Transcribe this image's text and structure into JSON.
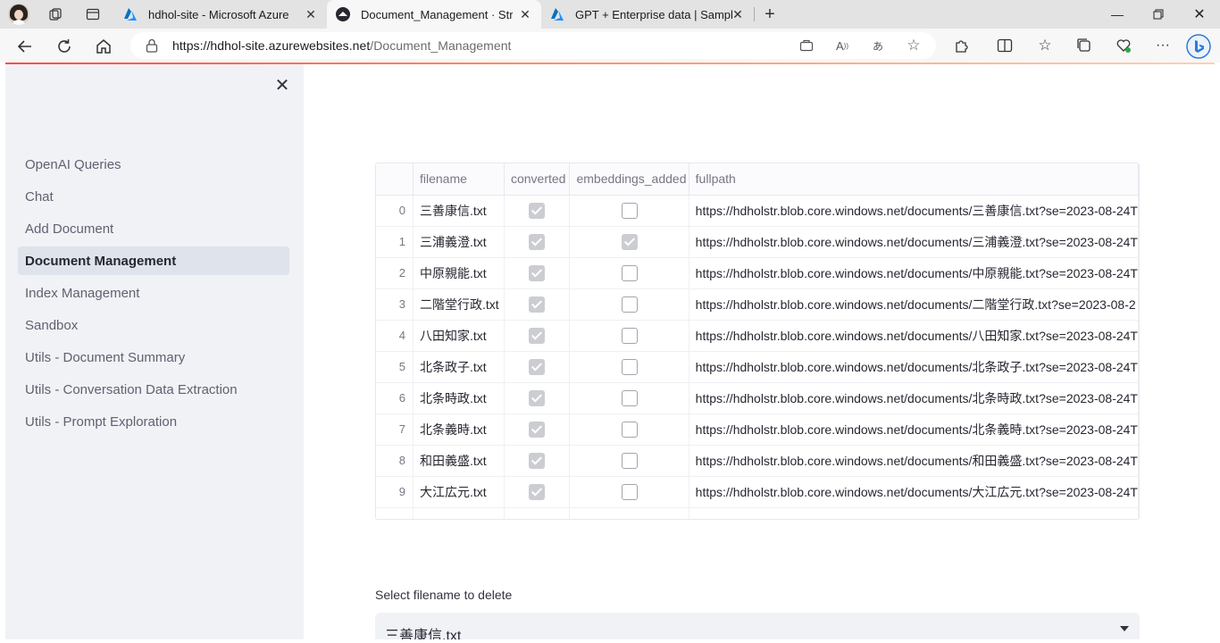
{
  "browser": {
    "tabs": [
      {
        "title": "hdhol-site - Microsoft Azure",
        "icon": "azure-icon",
        "active": false
      },
      {
        "title": "Document_Management · Streamlit",
        "icon": "streamlit-icon",
        "active": true
      },
      {
        "title": "GPT + Enterprise data | Sample",
        "icon": "azure-icon",
        "active": false
      }
    ],
    "url_host": "https://hdhol-site.azurewebsites.net",
    "url_path": "/Document_Management",
    "accent": "#ff4b4b"
  },
  "sidebar": {
    "items": [
      {
        "label": "OpenAI Queries",
        "active": false
      },
      {
        "label": "Chat",
        "active": false
      },
      {
        "label": "Add Document",
        "active": false
      },
      {
        "label": "Document Management",
        "active": true
      },
      {
        "label": "Index Management",
        "active": false
      },
      {
        "label": "Sandbox",
        "active": false
      },
      {
        "label": "Utils - Document Summary",
        "active": false
      },
      {
        "label": "Utils - Conversation Data Extraction",
        "active": false
      },
      {
        "label": "Utils - Prompt Exploration",
        "active": false
      }
    ]
  },
  "table": {
    "columns": [
      "",
      "filename",
      "converted",
      "embeddings_added",
      "fullpath"
    ],
    "rows": [
      {
        "index": "0",
        "filename": "三善康信.txt",
        "converted": true,
        "embeddings_added": false,
        "fullpath": "https://hdholstr.blob.core.windows.net/documents/三善康信.txt?se=2023-08-24T"
      },
      {
        "index": "1",
        "filename": "三浦義澄.txt",
        "converted": true,
        "embeddings_added": true,
        "fullpath": "https://hdholstr.blob.core.windows.net/documents/三浦義澄.txt?se=2023-08-24T"
      },
      {
        "index": "2",
        "filename": "中原親能.txt",
        "converted": true,
        "embeddings_added": false,
        "fullpath": "https://hdholstr.blob.core.windows.net/documents/中原親能.txt?se=2023-08-24T"
      },
      {
        "index": "3",
        "filename": "二階堂行政.txt",
        "converted": true,
        "embeddings_added": false,
        "fullpath": "https://hdholstr.blob.core.windows.net/documents/二階堂行政.txt?se=2023-08-2"
      },
      {
        "index": "4",
        "filename": "八田知家.txt",
        "converted": true,
        "embeddings_added": false,
        "fullpath": "https://hdholstr.blob.core.windows.net/documents/八田知家.txt?se=2023-08-24T"
      },
      {
        "index": "5",
        "filename": "北条政子.txt",
        "converted": true,
        "embeddings_added": false,
        "fullpath": "https://hdholstr.blob.core.windows.net/documents/北条政子.txt?se=2023-08-24T"
      },
      {
        "index": "6",
        "filename": "北条時政.txt",
        "converted": true,
        "embeddings_added": false,
        "fullpath": "https://hdholstr.blob.core.windows.net/documents/北条時政.txt?se=2023-08-24T"
      },
      {
        "index": "7",
        "filename": "北条義時.txt",
        "converted": true,
        "embeddings_added": false,
        "fullpath": "https://hdholstr.blob.core.windows.net/documents/北条義時.txt?se=2023-08-24T"
      },
      {
        "index": "8",
        "filename": "和田義盛.txt",
        "converted": true,
        "embeddings_added": false,
        "fullpath": "https://hdholstr.blob.core.windows.net/documents/和田義盛.txt?se=2023-08-24T"
      },
      {
        "index": "9",
        "filename": "大江広元.txt",
        "converted": true,
        "embeddings_added": false,
        "fullpath": "https://hdholstr.blob.core.windows.net/documents/大江広元.txt?se=2023-08-24T"
      }
    ]
  },
  "delete_select": {
    "label": "Select filename to delete",
    "value": "三善康信.txt"
  }
}
